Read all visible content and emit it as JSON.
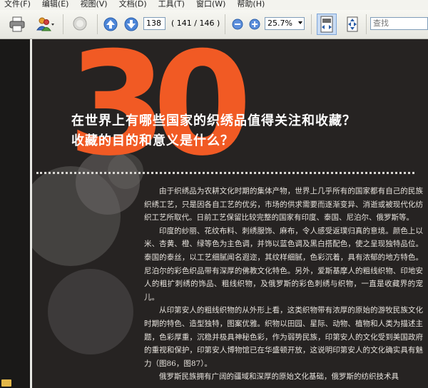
{
  "menu": [
    "文件(F)",
    "编辑(E)",
    "视图(V)",
    "文档(D)",
    "工具(T)",
    "窗口(W)",
    "帮助(H)"
  ],
  "toolbar": {
    "page_input": "138",
    "page_count": "( 141 / 146 )",
    "zoom": "25.7%",
    "search_placeholder": "查找"
  },
  "page": {
    "number": "30",
    "heading_line1": "在世界上有哪些国家的织绣品值得关注和收藏？",
    "heading_line2": "收藏的目的和意义是什么？",
    "paragraphs": [
      "由于织绣品为农耕文化时期的集体产物，世界上几乎所有的国家都有自己的民族织绣工艺，只是因各自工艺的优劣，市场的供求需要而逐渐变异、消逝或被现代化纺织工艺所取代。日前工艺保留比较完整的国家有印度、泰国、尼泊尔、俄罗斯等。",
      "印度的纱丽、花纹布料、刺绣服饰、麻布，令人感受返璞归真的意境。颜色上以米、杏黄、橙、绿等色为主色调，并饰以蓝色调及黑白搭配色，使之呈现独特品位。泰国的泰丝，以工艺细腻闻名遐迩，其纹样细腻，色彩沉着，具有浓郁的地方特色。尼泊尔的彩色织品带有深厚的佛教文化特色。另外，爱斯基摩人的粗线织物、印地安人的粗扩刺绣的饰品、粗线织物，及俄罗斯的彩色刺绣与织物，一直是收藏界的宠儿。",
      "从印第安人的粗线织物的从外形上看，这类织物带有浓厚的原始的游牧民族文化时期的特色、造型独特，图案优雅。织物以田园、星际、动物、植物和人类为描述主题，色彩厚重，沉稳并极具神秘色彩，作为弱势民族，印第安人的文化受到美国政府的重视和保护，印第安人博物馆已在华盛顿开放，这说明印第安人的文化确实具有魅力（图86，图87）。",
      "俄罗斯民族拥有广阔的疆域和深厚的原始文化基础，俄罗斯的纺织技术具"
    ]
  }
}
